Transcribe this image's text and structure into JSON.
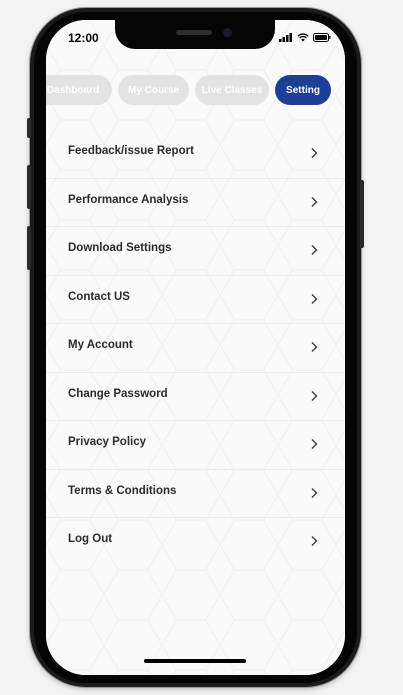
{
  "status_bar": {
    "time": "12:00",
    "icons": [
      "signal-icon",
      "wifi-icon",
      "battery-icon"
    ]
  },
  "tabs": [
    {
      "label": "Dashboard",
      "active": false
    },
    {
      "label": "My Course",
      "active": false
    },
    {
      "label": "Live Classes",
      "active": false
    },
    {
      "label": "Setting",
      "active": true
    }
  ],
  "menu": {
    "items": [
      {
        "label": "Feedback/issue Report"
      },
      {
        "label": "Performance Analysis"
      },
      {
        "label": "Download Settings"
      },
      {
        "label": "Contact US"
      },
      {
        "label": "My Account"
      },
      {
        "label": "Change Password"
      },
      {
        "label": "Privacy Policy"
      },
      {
        "label": "Terms & Conditions"
      },
      {
        "label": "Log Out"
      }
    ]
  },
  "colors": {
    "accent": "#1d3f97",
    "tab_inactive": "#e3e3e3",
    "text": "#2b2b2b"
  }
}
